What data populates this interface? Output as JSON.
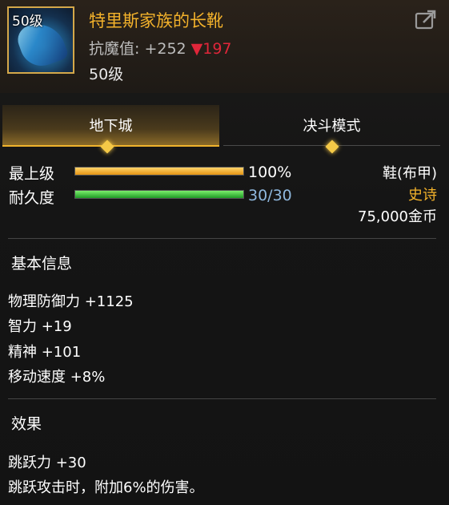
{
  "item": {
    "icon_level": "50级",
    "name": "特里斯家族的长靴",
    "resist_label": "抗魔值: +252",
    "resist_change": "▼197",
    "required_level": "50级"
  },
  "tabs": [
    {
      "label": "地下城",
      "active": true
    },
    {
      "label": "决斗模式",
      "active": false
    }
  ],
  "status": {
    "level_label": "最上级",
    "level_value": "100%",
    "level_fraction": 1.0,
    "durability_label": "耐久度",
    "durability_value": "30/30",
    "durability_fraction": 1.0
  },
  "meta": {
    "type": "鞋(布甲)",
    "rarity": "史诗",
    "price": "75,000金币"
  },
  "basic_info": {
    "title": "基本信息",
    "stats": [
      "物理防御力 +1125",
      "智力 +19",
      "精神 +101",
      "移动速度 +8%"
    ]
  },
  "effects": {
    "title": "效果",
    "lines": [
      "跳跃力 +30",
      "跳跃攻击时，附加6%的伤害。"
    ]
  },
  "colors": {
    "name": "#f3b22b",
    "rarity": "#f3b22b",
    "resist_down": "#e0263a",
    "durability_value": "#8fb8de"
  },
  "icons": {
    "share": "share-icon",
    "item": "boot-icon"
  }
}
